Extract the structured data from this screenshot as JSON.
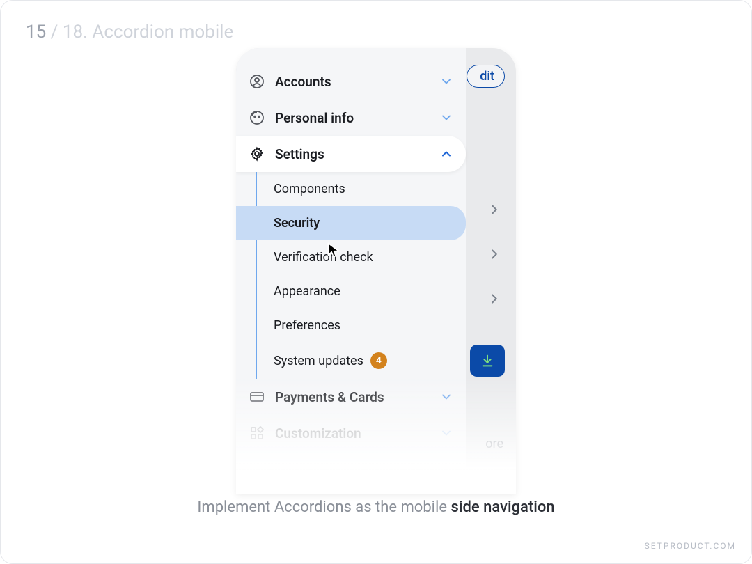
{
  "slide": {
    "page_current": "15",
    "page_sep": " / ",
    "page_total_and_title": "18. Accordion mobile"
  },
  "backdrop": {
    "edit_label": "dit",
    "more_label": "ore"
  },
  "accordion": {
    "accounts": "Accounts",
    "personal_info": "Personal info",
    "settings": "Settings",
    "settings_children": {
      "components": "Components",
      "security": "Security",
      "verification": "Verification check",
      "appearance": "Appearance",
      "preferences": "Preferences",
      "system_updates": "System updates",
      "system_updates_badge": "4"
    },
    "payments": "Payments & Cards",
    "customization": "Customization"
  },
  "caption": {
    "prefix": "Implement Accordions as the mobile ",
    "strong": "side navigation"
  },
  "watermark": "SETPRODUCT.COM"
}
